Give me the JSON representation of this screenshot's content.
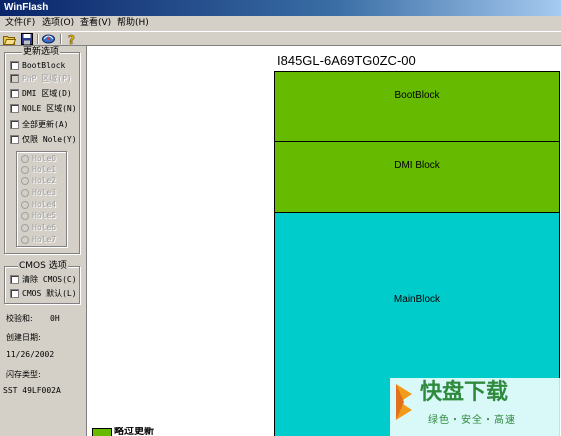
{
  "window": {
    "title": "WinFlash"
  },
  "menu": [
    {
      "label": "文件(F)"
    },
    {
      "label": "选项(O)"
    },
    {
      "label": "查看(V)"
    },
    {
      "label": "帮助(H)"
    }
  ],
  "toolbar": {
    "buttons": [
      {
        "icon": "open-folder-icon"
      },
      {
        "icon": "save-icon"
      },
      {
        "icon": "flash-icon"
      },
      {
        "icon": "help-icon"
      }
    ]
  },
  "update_options": {
    "title": "更新选项",
    "items": [
      {
        "label": "BootBlock",
        "checked": false,
        "enabled": true
      },
      {
        "label": "PnP 区域(P)",
        "checked": false,
        "enabled": false
      },
      {
        "label": "DMI 区域(D)",
        "checked": false,
        "enabled": true
      },
      {
        "label": "NOLE 区域(N)",
        "checked": false,
        "enabled": true
      },
      {
        "label": "全部更新(A)",
        "checked": false,
        "enabled": true
      },
      {
        "label": "仅限 Nole(Y)",
        "checked": false,
        "enabled": true
      }
    ],
    "holes": [
      "Hole0",
      "Hole1",
      "Hole2",
      "Hole3",
      "Hole4",
      "Hole5",
      "Hole6",
      "Hole7"
    ]
  },
  "cmos_options": {
    "title": "CMOS 选项",
    "items": [
      {
        "label": "清除 CMOS(C)",
        "checked": false
      },
      {
        "label": "CMOS 默认(L)",
        "checked": false
      }
    ]
  },
  "info": {
    "checksum_label": "校验和:",
    "checksum_value": "0H",
    "date_label": "创建日期:",
    "date_value": "11/26/2002",
    "flash_type_label": "闪存类型:",
    "flash_type_value": "SST 49LF002A"
  },
  "main": {
    "chip_id": "I845GL-6A69TG0ZC-00",
    "blocks": [
      {
        "label": "BootBlock",
        "color": "#66bb00"
      },
      {
        "label": "DMI Block",
        "color": "#66bb00"
      },
      {
        "label": "MainBlock",
        "color": "#00cccc"
      }
    ],
    "legend": {
      "label": "略过更新",
      "color": "#66bb00"
    }
  },
  "watermark": {
    "title": "快盘下载",
    "subtitle": "绿色・安全・高速"
  }
}
